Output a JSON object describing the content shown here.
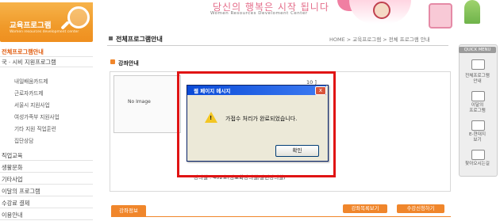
{
  "header": {
    "section_title": "교육프로그램",
    "section_subtitle": "Women resources development center",
    "slogan": "당신의 행복은 시작 됩니다",
    "slogan_sub": "Women Resources Develoment Center"
  },
  "leftnav": {
    "main_items": [
      "전체프로그램안내",
      "국 · 시비 지원프로그램",
      "직업교육",
      "생활문화",
      "기타사업",
      "이달의 프로그램",
      "수강료 결제",
      "이용안내"
    ],
    "active_index": 0,
    "sub_items": [
      "내일배움카드제",
      "근로자카드제",
      "서울시 지원사업",
      "여성가족부 지원사업",
      "기타 지원 직업훈련",
      "집단상담"
    ]
  },
  "main": {
    "page_heading": "전체프로그램안내",
    "breadcrumb": "HOME > 교육프로그램 > 전체 프로그램 안내",
    "course_heading": "강좌안내",
    "no_image": "No Image",
    "course_date": "10 ]",
    "course_info": "강의실 : 402호(정보화강의실/갈런강의실)",
    "tab_info": "강좌정보",
    "btn_list": "강좌목록보기",
    "btn_apply": "수강신청하기"
  },
  "quick_menu": {
    "title": "QUICK MENU",
    "items": [
      {
        "label1": "전체프로그램",
        "label2": "안내",
        "icon": "document-icon"
      },
      {
        "label1": "이달의",
        "label2": "프로그램",
        "icon": "calendar-icon"
      },
      {
        "label1": "E-현대지",
        "label2": "보기",
        "icon": "book-icon"
      },
      {
        "label1": "찾아오시는길",
        "label2": "",
        "icon": "map-icon"
      }
    ]
  },
  "dialog": {
    "title": "웹 페이지 메시지",
    "message": "가접수 처리가 완료되었습니다.",
    "ok_label": "확인",
    "close_label": "x"
  },
  "colors": {
    "accent_orange": "#f0862b",
    "highlight_red": "#e01414",
    "dialog_title_blue": "#0a4ad7"
  }
}
